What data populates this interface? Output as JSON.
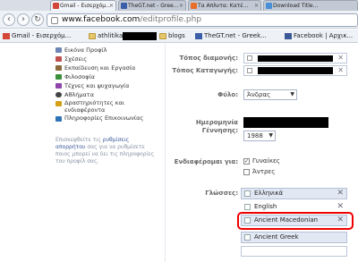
{
  "browser": {
    "tabs": [
      {
        "title": "Gmail - Εισερχόμ...",
        "fav_color": "#d44638"
      },
      {
        "title": "TheGT.net - Gree...",
        "fav_color": "#3a5fa8"
      },
      {
        "title": "Τα Απλυτα: Κατέ...",
        "fav_color": "#e76f2a"
      },
      {
        "title": "Download Title...",
        "fav_color": "#4a90d9"
      }
    ],
    "url_host": "www.facebook.com",
    "url_path": "/editprofile.php",
    "bookmarks": {
      "gmail": "Gmail - Εισερχόμ...",
      "athlitika": "athlitika",
      "blogs": "blogs",
      "thegt": "TheGT.net - Greek...",
      "facebook": "Facebook | Αρχικ..."
    }
  },
  "sidebar": {
    "items": [
      {
        "label": "Εικόνα Προφίλ",
        "icon": "profile-picture-icon",
        "color": "#6d84b4"
      },
      {
        "label": "Σχέσεις",
        "icon": "relationships-icon",
        "color": "#c0504d"
      },
      {
        "label": "Εκπαίδευση και Εργασία",
        "icon": "education-icon",
        "color": "#8b6a3d"
      },
      {
        "label": "Φιλοσοφία",
        "icon": "philosophy-icon",
        "color": "#3b8f3b"
      },
      {
        "label": "Τέχνες και ψυχαγωγία",
        "icon": "arts-icon",
        "color": "#8e44ad"
      },
      {
        "label": "Αθλήματα",
        "icon": "sports-icon",
        "color": "#444444"
      },
      {
        "label": "Δραστηριότητες και ενδιαφέροντα",
        "icon": "activities-icon",
        "color": "#d4a017"
      },
      {
        "label": "Πληροφορίες Επικοινωνίας",
        "icon": "contact-icon",
        "color": "#2e74b5"
      }
    ],
    "note_before": "Επισκεφθείτε τις ",
    "note_link": "ρυθμίσεις απορρήτου",
    "note_after": " σας για να ρυθμίσετε ποιος μπορεί να δει τις πληροφορίες του προφίλ σας."
  },
  "form": {
    "residence_label": "Τόπος διαμονής:",
    "hometown_label": "Τόπος Καταγωγής:",
    "sex_label": "Φύλο:",
    "sex_value": "Άνδρας",
    "birthday_label": "Ημερομηνία Γέννησης:",
    "birth_year": "1988",
    "interested_label": "Ενδιαφέρομαι για:",
    "interested_women": "Γυναίκες",
    "interested_men": "Άντρες",
    "languages_label": "Γλώσσες:",
    "languages": [
      "Ελληνικά",
      "English",
      "Ancient Macedonian",
      "Ancient Greek"
    ],
    "remove_glyph": "✕"
  }
}
